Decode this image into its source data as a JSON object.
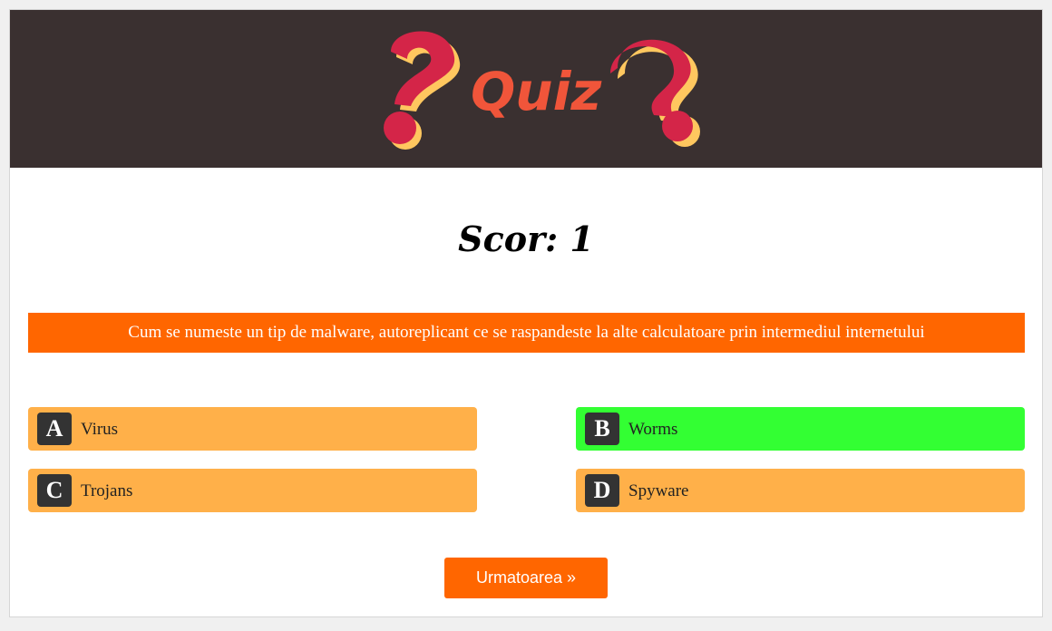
{
  "header": {
    "logo_text": "Quiz"
  },
  "score": {
    "text": "Scor: 1"
  },
  "question": {
    "text": "Cum se numeste un tip de malware, autoreplicant ce se raspandeste la alte calculatoare prin intermediul internetului"
  },
  "answers": [
    {
      "letter": "A",
      "label": "Virus",
      "state": "default"
    },
    {
      "letter": "B",
      "label": "Worms",
      "state": "correct"
    },
    {
      "letter": "C",
      "label": "Trojans",
      "state": "default"
    },
    {
      "letter": "D",
      "label": "Spyware",
      "state": "default"
    }
  ],
  "next_button": {
    "label": "Urmatoarea »"
  },
  "colors": {
    "header_bg": "#3a3030",
    "accent_orange": "#ff6600",
    "answer_bg": "#ffb049",
    "answer_correct_bg": "#33ff33",
    "logo_red": "#d42548",
    "logo_yellow": "#ffc75f",
    "logo_text": "#f0553a"
  }
}
